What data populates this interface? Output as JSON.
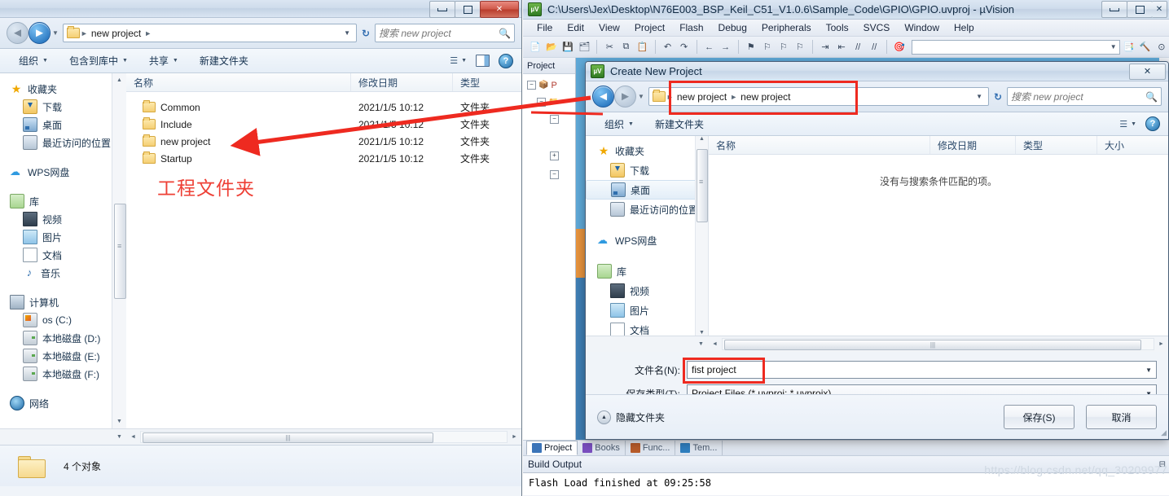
{
  "explorer": {
    "window_controls": {
      "minimize": "minimize-icon",
      "maximize": "maximize-icon",
      "close": "close-icon"
    },
    "address": {
      "crumbs": [
        "new project"
      ],
      "dropdown_caret": "chevron-down-icon",
      "refresh": "refresh-icon"
    },
    "search": {
      "placeholder": "搜索 new project",
      "icon": "search-icon"
    },
    "toolbar": {
      "organize": "组织",
      "include_in_library": "包含到库中",
      "share": "共享",
      "new_folder": "新建文件夹",
      "view_icon": "view-list-icon",
      "preview_icon": "preview-pane-icon",
      "help_icon": "help-icon"
    },
    "sidebar": {
      "sections": [
        {
          "label": "收藏夹",
          "icon": "star-icon",
          "level": 0
        },
        {
          "label": "下载",
          "icon": "downloads-icon",
          "level": 1
        },
        {
          "label": "桌面",
          "icon": "desktop-icon",
          "level": 1
        },
        {
          "label": "最近访问的位置",
          "icon": "recent-places-icon",
          "level": 1
        },
        {
          "label": "WPS网盘",
          "icon": "cloud-icon",
          "level": 0
        },
        {
          "label": "库",
          "icon": "library-icon",
          "level": 0
        },
        {
          "label": "视频",
          "icon": "video-icon",
          "level": 1
        },
        {
          "label": "图片",
          "icon": "picture-icon",
          "level": 1
        },
        {
          "label": "文档",
          "icon": "document-icon",
          "level": 1
        },
        {
          "label": "音乐",
          "icon": "music-icon",
          "level": 1
        },
        {
          "label": "计算机",
          "icon": "computer-icon",
          "level": 0
        },
        {
          "label": "os (C:)",
          "icon": "os-drive-icon",
          "level": 1
        },
        {
          "label": "本地磁盘 (D:)",
          "icon": "drive-icon",
          "level": 1
        },
        {
          "label": "本地磁盘 (E:)",
          "icon": "drive-icon",
          "level": 1
        },
        {
          "label": "本地磁盘 (F:)",
          "icon": "drive-icon",
          "level": 1
        },
        {
          "label": "网络",
          "icon": "network-icon",
          "level": 0
        }
      ]
    },
    "columns": {
      "name": "名称",
      "modified": "修改日期",
      "type": "类型"
    },
    "files": [
      {
        "name": "Common",
        "modified": "2021/1/5 10:12",
        "type": "文件夹"
      },
      {
        "name": "Include",
        "modified": "2021/1/5 10:12",
        "type": "文件夹"
      },
      {
        "name": "new project",
        "modified": "2021/1/5 10:12",
        "type": "文件夹"
      },
      {
        "name": "Startup",
        "modified": "2021/1/5 10:12",
        "type": "文件夹"
      }
    ],
    "annotation": "工程文件夹",
    "annotation_color": "#ee4036",
    "status": "4 个对象"
  },
  "keil": {
    "title": "C:\\Users\\Jex\\Desktop\\N76E003_BSP_Keil_C51_V1.0.6\\Sample_Code\\GPIO\\GPIO.uvproj - µVision",
    "logo": "uvision-logo-icon",
    "window_controls": {
      "minimize": "minimize-icon",
      "maximize": "maximize-icon",
      "close": "close-icon"
    },
    "menus": [
      "File",
      "Edit",
      "View",
      "Project",
      "Flash",
      "Debug",
      "Peripherals",
      "Tools",
      "SVCS",
      "Window",
      "Help"
    ],
    "project_pane": {
      "title": "Project"
    },
    "tabs": [
      {
        "label": "Project",
        "icon": "project-tab-icon",
        "active": true
      },
      {
        "label": "Books",
        "icon": "books-tab-icon",
        "active": false
      },
      {
        "label": "Func...",
        "icon": "functions-tab-icon",
        "active": false
      },
      {
        "label": "Tem...",
        "icon": "templates-tab-icon",
        "active": false
      }
    ],
    "build_output": {
      "title": "Build Output",
      "pin_icon": "pin-icon",
      "lines": [
        "Flash Load finished at 09:25:58"
      ]
    },
    "watermark": "https://blog.csdn.net/qq_30209977"
  },
  "dialog": {
    "title": "Create New Project",
    "logo": "uvision-logo-icon",
    "close_label": "✕",
    "address": {
      "crumbs": [
        "new project",
        "new project"
      ],
      "highlight_color": "#ee2a20"
    },
    "search": {
      "placeholder": "搜索 new project",
      "icon": "search-icon"
    },
    "toolbar": {
      "organize": "组织",
      "new_folder": "新建文件夹",
      "view_icon": "view-list-icon",
      "help_icon": "help-icon"
    },
    "sidebar": {
      "items": [
        {
          "label": "收藏夹",
          "icon": "star-icon",
          "level": 0,
          "selected": false
        },
        {
          "label": "下载",
          "icon": "downloads-icon",
          "level": 1,
          "selected": false
        },
        {
          "label": "桌面",
          "icon": "desktop-icon",
          "level": 1,
          "selected": true
        },
        {
          "label": "最近访问的位置",
          "icon": "recent-places-icon",
          "level": 1,
          "selected": false
        },
        {
          "label": "WPS网盘",
          "icon": "cloud-icon",
          "level": 0,
          "selected": false
        },
        {
          "label": "库",
          "icon": "library-icon",
          "level": 0,
          "selected": false
        },
        {
          "label": "视频",
          "icon": "video-icon",
          "level": 1,
          "selected": false
        },
        {
          "label": "图片",
          "icon": "picture-icon",
          "level": 1,
          "selected": false
        },
        {
          "label": "文档",
          "icon": "document-icon",
          "level": 1,
          "selected": false
        }
      ]
    },
    "columns": {
      "name": "名称",
      "modified": "修改日期",
      "type": "类型",
      "size": "大小"
    },
    "empty_message": "没有与搜索条件匹配的项。",
    "filename": {
      "label": "文件名(N):",
      "value": "fist project",
      "highlight_color": "#ee2a20"
    },
    "filetype": {
      "label": "保存类型(T):",
      "value": "Project Files (*.uvproj; *.uvprojx)"
    },
    "hide_folders": "隐藏文件夹",
    "buttons": {
      "save": "保存(S)",
      "cancel": "取消"
    }
  }
}
